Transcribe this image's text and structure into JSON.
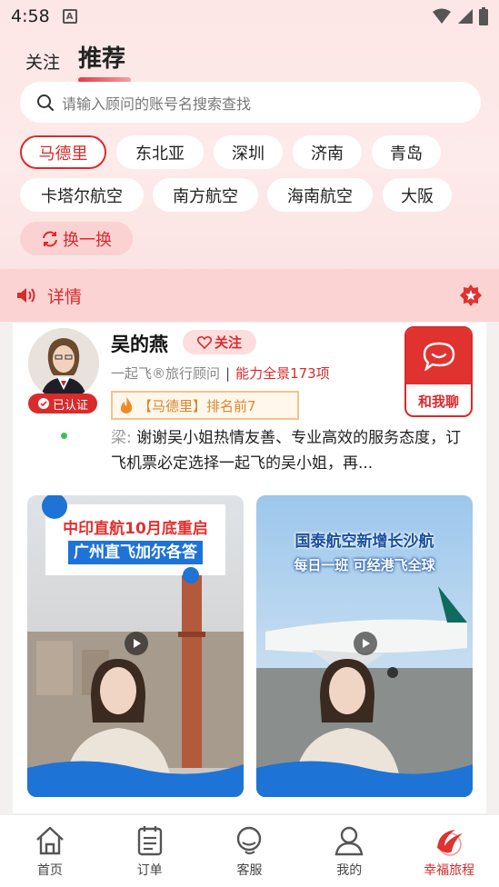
{
  "status": {
    "time": "4:58",
    "icon_a": "A"
  },
  "tabs": {
    "follow": "关注",
    "recommend": "推荐"
  },
  "search": {
    "placeholder": "请输入顾问的账号名搜索查找"
  },
  "chips": [
    "马德里",
    "东北亚",
    "深圳",
    "济南",
    "青岛",
    "卡塔尔航空",
    "南方航空",
    "海南航空",
    "大阪"
  ],
  "swap_label": "换一换",
  "detail": {
    "label": "详情"
  },
  "advisor": {
    "name": "吴的燕",
    "follow_label": "关注",
    "verified": "已认证",
    "title": "一起飞®旅行顾问",
    "separator": "|",
    "ability": "能力全景173项",
    "rank": "【马德里】排名前7",
    "chat_label": "和我聊",
    "review_author": "梁:",
    "review_text": "谢谢吴小姐热情友善、专业高效的服务态度，订飞机票必定选择一起飞的吴小姐，再..."
  },
  "videos": [
    {
      "title_line1": "中印直航10月底重启",
      "title_line2": "广州直飞加尔各答"
    },
    {
      "title_line1": "国泰航空新增长沙航",
      "title_line2": "每日一班 可经港飞全球"
    }
  ],
  "nav": [
    {
      "label": "首页",
      "icon": "home-icon"
    },
    {
      "label": "订单",
      "icon": "order-icon"
    },
    {
      "label": "客服",
      "icon": "service-icon"
    },
    {
      "label": "我的",
      "icon": "profile-icon"
    },
    {
      "label": "幸福旅程",
      "icon": "happy-journey-icon"
    }
  ],
  "colors": {
    "accent": "#d92b2b",
    "rank": "#d9872b",
    "online": "#3cbf5a"
  }
}
